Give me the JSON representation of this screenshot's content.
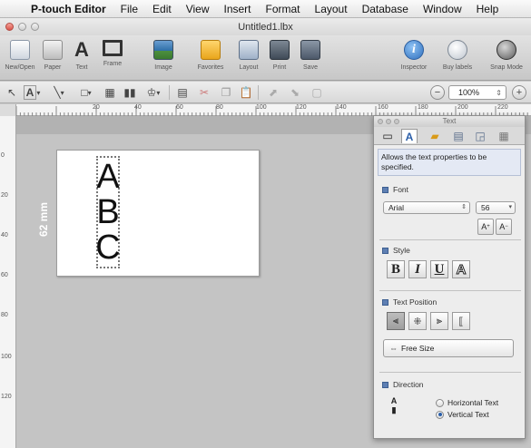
{
  "menubar": {
    "apple_icon": "apple-icon",
    "items": [
      "P-touch Editor",
      "File",
      "Edit",
      "View",
      "Insert",
      "Format",
      "Layout",
      "Database",
      "Window",
      "Help"
    ]
  },
  "window": {
    "title": "Untitled1.lbx"
  },
  "toolbar": {
    "buttons": [
      {
        "label": "New/Open",
        "icon": "new-open-icon"
      },
      {
        "label": "Paper",
        "icon": "paper-icon"
      },
      {
        "label": "Text",
        "icon": "text-icon"
      },
      {
        "label": "Frame",
        "icon": "frame-icon"
      },
      {
        "label": "Image",
        "icon": "image-icon"
      },
      {
        "label": "Favorites",
        "icon": "favorites-icon"
      },
      {
        "label": "Layout",
        "icon": "layout-icon"
      },
      {
        "label": "Print",
        "icon": "print-icon"
      },
      {
        "label": "Save",
        "icon": "save-icon"
      },
      {
        "label": "Inspector",
        "icon": "inspector-icon"
      },
      {
        "label": "Buy labels",
        "icon": "buy-labels-icon"
      },
      {
        "label": "Snap Mode",
        "icon": "snap-mode-icon"
      }
    ],
    "text_glyph": "A",
    "inspector_glyph": "i"
  },
  "format_bar": {
    "zoom_value": "100%",
    "zoom_out": "−",
    "zoom_in": "+"
  },
  "ruler": {
    "h_labels": [
      "20",
      "40",
      "60",
      "80",
      "100",
      "120",
      "140",
      "160",
      "180",
      "200",
      "220"
    ],
    "v_labels": [
      "0",
      "20",
      "40",
      "60",
      "80",
      "100",
      "120"
    ]
  },
  "canvas": {
    "length_label": "62 mm",
    "text_object": [
      "A",
      "B",
      "C"
    ]
  },
  "inspector": {
    "title": "Text",
    "hint": "Allows the text properties to be specified.",
    "font": {
      "heading": "Font",
      "family": "Arial",
      "size": "56",
      "grow_label": "A",
      "shrink_label": "A"
    },
    "style": {
      "heading": "Style",
      "bold": "B",
      "italic": "I",
      "underline": "U",
      "outline": "A"
    },
    "text_position": {
      "heading": "Text Position",
      "free_size_label": "Free Size"
    },
    "direction": {
      "heading": "Direction",
      "horizontal_label": "Horizontal Text",
      "vertical_label": "Vertical Text",
      "selected": "Vertical Text"
    }
  }
}
